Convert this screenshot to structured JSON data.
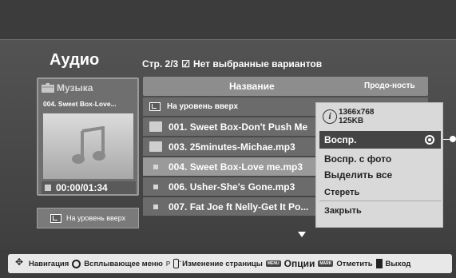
{
  "screen": {
    "title": "Аудио",
    "page_info": "Стр. 2/3",
    "selection_checkbox": "☑",
    "selection_text": "Нет выбранные вариантов"
  },
  "preview": {
    "folder_label": "Музыка",
    "current_track": "004. Sweet Box-Love...",
    "time": "00:00/01:34",
    "up_button": "На уровень вверх"
  },
  "list": {
    "col_name": "Название",
    "col_duration": "Продо-ность",
    "rows": [
      {
        "label": "На уровень вверх",
        "type": "up"
      },
      {
        "label": "001. Sweet Box-Don't Push Me",
        "type": "folder"
      },
      {
        "label": "003. 25minutes-Michae.mp3",
        "type": "folder"
      },
      {
        "label": "004. Sweet Box-Love me.mp3",
        "type": "file",
        "selected": true
      },
      {
        "label": "006. Usher-She's Gone.mp3",
        "type": "file"
      },
      {
        "label": "007. Fat Joe ft Nelly-Get It Po...",
        "type": "file"
      }
    ]
  },
  "popup": {
    "resolution": "1366x768",
    "size": "125KB",
    "items": [
      "Воспр.",
      "Воспр. с фото",
      "Выделить все",
      "Стереть",
      "Закрыть"
    ]
  },
  "footer": {
    "navigation": "Навигация",
    "popup_menu": "Всплывающее меню",
    "page_prefix": "P",
    "page_change": "Изменение страницы",
    "menu_key": "MENU",
    "options": "Опции",
    "mark_key": "MARK",
    "mark": "Отметить",
    "exit": "Выход"
  },
  "colors": {
    "background": "#4a4a4a",
    "popup_bg": "#d9d9d9",
    "popup_active": "#444444",
    "footer_bar": "#e8e8e8"
  }
}
